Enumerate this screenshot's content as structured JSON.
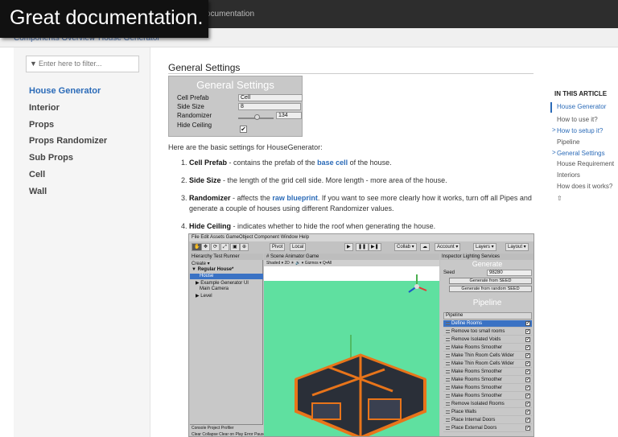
{
  "caption": {
    "text": "Great documentation."
  },
  "topbar": {
    "nav_label": "ocumentation"
  },
  "breadcrumb": {
    "items": [
      "Components Overview",
      "House Generator"
    ],
    "separator": ">"
  },
  "sidebar": {
    "filter_placeholder": "Enter here to filter...",
    "items": [
      {
        "label": "House Generator",
        "active": true
      },
      {
        "label": "Interior"
      },
      {
        "label": "Props"
      },
      {
        "label": "Props Randomizer"
      },
      {
        "label": "Sub Props"
      },
      {
        "label": "Cell"
      },
      {
        "label": "Wall"
      }
    ]
  },
  "main": {
    "heading": "General Settings",
    "settings_panel": {
      "title": "General Settings",
      "rows": [
        {
          "label": "Cell Prefab",
          "value": "Cell"
        },
        {
          "label": "Side Size",
          "value": "8"
        },
        {
          "label": "Randomizer",
          "value": "134"
        },
        {
          "label": "Hide Ceiling",
          "value": "✔"
        }
      ]
    },
    "intro": "Here are the basic settings for HouseGenerator:",
    "list": [
      {
        "num": "1.",
        "term": "Cell Prefab",
        "pre": " - contains the prefab of the ",
        "link": "base cell",
        "post": " of the house."
      },
      {
        "num": "2.",
        "term": "Side Size",
        "pre": " - the length of the grid cell side. More length - more area of the house.",
        "link": "",
        "post": ""
      },
      {
        "num": "3.",
        "term": "Randomizer",
        "pre": " - affects the ",
        "link": "raw blueprint",
        "post": ". If you want to see more clearly how it works, turn off all Pipes and generate a couple of houses using different Randomizer values."
      },
      {
        "num": "4.",
        "term": "Hide Ceiling",
        "pre": " - indicates whether to hide the roof when generating the house.",
        "link": "",
        "post": ""
      }
    ]
  },
  "toc": {
    "heading": "IN THIS ARTICLE",
    "items": [
      {
        "label": "House Generator",
        "active": true
      },
      {
        "label": "How to use it?"
      },
      {
        "label": "How to setup it?",
        "arrow": ">"
      },
      {
        "label": "Pipeline"
      },
      {
        "label": "General Settings",
        "arrow": ">"
      },
      {
        "label": "House Requirement"
      },
      {
        "label": "Interiors"
      },
      {
        "label": "How does it works?"
      }
    ],
    "back_to_top": "⇧"
  },
  "unity": {
    "menu": "File   Edit   Assets   GameObject   Component   Window   Help",
    "toolbar": {
      "tools": [
        "✋",
        "✥",
        "⟳",
        "⤢",
        "▣",
        "⊕"
      ],
      "pivot": "Pivot",
      "local": "Local",
      "play": "▶",
      "pause": "❚❚",
      "step": "▶❚",
      "collab": "Collab ▾",
      "cloud": "☁",
      "account": "Account ▾",
      "layers": "Layers ▾",
      "layout": "Layout ▾"
    },
    "hierarchy": {
      "tabs": "Hierarchy   Test Runner",
      "create": "Create ▾",
      "root": "▼ Regular House*",
      "items": [
        "House",
        "▶ Example Generator UI",
        "Main Camera",
        "▶ Level"
      ]
    },
    "console": {
      "tabs": "Console   Project   Profiler",
      "buttons": "Clear   Collapse   Clear on Play   Error Pause"
    },
    "scene": {
      "tabs": "# Scene      Animator      Game",
      "bar": "Shaded     ▾   2D   ☀   🔊   ▾   Gizmos ▾   Q•All"
    },
    "inspector": {
      "tabs": "Inspector   Lighting   Services",
      "generate_title": "Generate",
      "seed_label": "Seed",
      "seed_value": "98280",
      "btn_seed": "Generate from SEED",
      "btn_random": "Generate from random SEED",
      "pipeline_title": "Pipeline",
      "pipeline_header": "Pipeline",
      "pipeline_items": [
        "Define Rooms",
        "Remove too small rooms",
        "Remove Isolated Voids",
        "Make Rooms Smoother",
        "Make Thin Room Cells Wider",
        "Make Thin Room Cells Wider",
        "Make Rooms Smoother",
        "Make Rooms Smoother",
        "Make Rooms Smoother",
        "Make Rooms Smoother",
        "Remove Isolated Rooms",
        "Place Walls",
        "Place Internal Doors",
        "Place External Doors"
      ],
      "check": "✔"
    }
  },
  "colors": {
    "accent": "#2b6bb8",
    "scene_bg": "#5fe0a0",
    "house_orange": "#e8741a",
    "unity_select": "#3a72c4"
  }
}
